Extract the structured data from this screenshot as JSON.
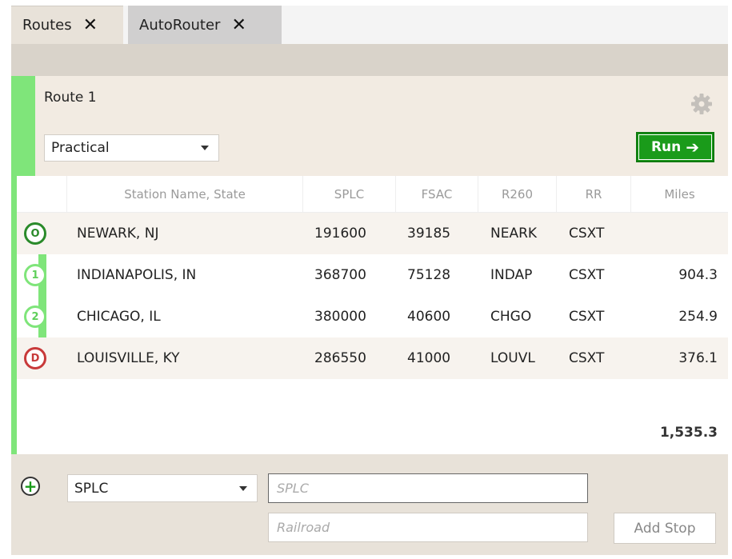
{
  "tabs": [
    {
      "label": "Routes",
      "close": "✕"
    },
    {
      "label": "AutoRouter",
      "close": "✕"
    }
  ],
  "route": {
    "title": "Route 1",
    "mode": "Practical",
    "run_label": "Run",
    "run_arrow": "➔"
  },
  "table": {
    "headers": [
      "Station Name, State",
      "SPLC",
      "FSAC",
      "R260",
      "RR",
      "Miles"
    ],
    "rows": [
      {
        "marker": "O",
        "station": "NEWARK, NJ",
        "splc": "191600",
        "fsac": "39185",
        "r260": "NEARK",
        "rr": "CSXT",
        "miles": ""
      },
      {
        "marker": "1",
        "station": "INDIANAPOLIS, IN",
        "splc": "368700",
        "fsac": "75128",
        "r260": "INDAP",
        "rr": "CSXT",
        "miles": "904.3"
      },
      {
        "marker": "2",
        "station": "CHICAGO, IL",
        "splc": "380000",
        "fsac": "40600",
        "r260": "CHGO",
        "rr": "CSXT",
        "miles": "254.9"
      },
      {
        "marker": "D",
        "station": "LOUISVILLE, KY",
        "splc": "286550",
        "fsac": "41000",
        "r260": "LOUVL",
        "rr": "CSXT",
        "miles": "376.1"
      }
    ],
    "total_miles": "1,535.3"
  },
  "add_stop": {
    "add_icon": "+",
    "type_value": "SPLC",
    "splc_placeholder": "SPLC",
    "railroad_placeholder": "Railroad",
    "button_label": "Add Stop"
  },
  "colors": {
    "accent_green": "#7fe57a",
    "run_green": "#1a9b1a",
    "origin_green": "#2a8a2a",
    "destination_red": "#c83a3a",
    "panel_bg": "#f2ebe2"
  },
  "icons": {
    "settings": "gear-icon",
    "close": "close-icon",
    "add": "plus-circle-icon",
    "run": "arrow-right-icon",
    "dropdown": "chevron-down-icon"
  }
}
